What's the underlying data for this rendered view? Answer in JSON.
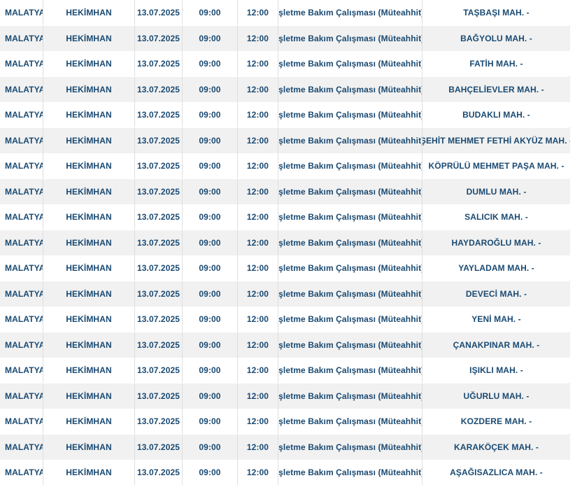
{
  "table": {
    "rows": [
      {
        "city": "MALATYA",
        "district": "HEKİMHAN",
        "date": "13.07.2025",
        "start": "09:00",
        "end": "12:00",
        "reason": "İşletme Bakım Çalışması (Müteahhit)",
        "place": "TAŞBAŞI MAH. -"
      },
      {
        "city": "MALATYA",
        "district": "HEKİMHAN",
        "date": "13.07.2025",
        "start": "09:00",
        "end": "12:00",
        "reason": "İşletme Bakım Çalışması (Müteahhit)",
        "place": "BAĞYOLU MAH. -"
      },
      {
        "city": "MALATYA",
        "district": "HEKİMHAN",
        "date": "13.07.2025",
        "start": "09:00",
        "end": "12:00",
        "reason": "İşletme Bakım Çalışması (Müteahhit)",
        "place": "FATİH MAH. -"
      },
      {
        "city": "MALATYA",
        "district": "HEKİMHAN",
        "date": "13.07.2025",
        "start": "09:00",
        "end": "12:00",
        "reason": "İşletme Bakım Çalışması (Müteahhit)",
        "place": "BAHÇELİEVLER MAH. -"
      },
      {
        "city": "MALATYA",
        "district": "HEKİMHAN",
        "date": "13.07.2025",
        "start": "09:00",
        "end": "12:00",
        "reason": "İşletme Bakım Çalışması (Müteahhit)",
        "place": "BUDAKLI MAH. -"
      },
      {
        "city": "MALATYA",
        "district": "HEKİMHAN",
        "date": "13.07.2025",
        "start": "09:00",
        "end": "12:00",
        "reason": "İşletme Bakım Çalışması (Müteahhit)",
        "place": "ŞEHİT MEHMET FETHİ AKYÜZ MAH. -"
      },
      {
        "city": "MALATYA",
        "district": "HEKİMHAN",
        "date": "13.07.2025",
        "start": "09:00",
        "end": "12:00",
        "reason": "İşletme Bakım Çalışması (Müteahhit)",
        "place": "KÖPRÜLÜ MEHMET PAŞA MAH. -"
      },
      {
        "city": "MALATYA",
        "district": "HEKİMHAN",
        "date": "13.07.2025",
        "start": "09:00",
        "end": "12:00",
        "reason": "İşletme Bakım Çalışması (Müteahhit)",
        "place": "DUMLU MAH. -"
      },
      {
        "city": "MALATYA",
        "district": "HEKİMHAN",
        "date": "13.07.2025",
        "start": "09:00",
        "end": "12:00",
        "reason": "İşletme Bakım Çalışması (Müteahhit)",
        "place": "SALICIK MAH. -"
      },
      {
        "city": "MALATYA",
        "district": "HEKİMHAN",
        "date": "13.07.2025",
        "start": "09:00",
        "end": "12:00",
        "reason": "İşletme Bakım Çalışması (Müteahhit)",
        "place": "HAYDAROĞLU MAH. -"
      },
      {
        "city": "MALATYA",
        "district": "HEKİMHAN",
        "date": "13.07.2025",
        "start": "09:00",
        "end": "12:00",
        "reason": "İşletme Bakım Çalışması (Müteahhit)",
        "place": "YAYLADAM MAH. -"
      },
      {
        "city": "MALATYA",
        "district": "HEKİMHAN",
        "date": "13.07.2025",
        "start": "09:00",
        "end": "12:00",
        "reason": "İşletme Bakım Çalışması (Müteahhit)",
        "place": "DEVECİ MAH. -"
      },
      {
        "city": "MALATYA",
        "district": "HEKİMHAN",
        "date": "13.07.2025",
        "start": "09:00",
        "end": "12:00",
        "reason": "İşletme Bakım Çalışması (Müteahhit)",
        "place": "YENİ MAH. -"
      },
      {
        "city": "MALATYA",
        "district": "HEKİMHAN",
        "date": "13.07.2025",
        "start": "09:00",
        "end": "12:00",
        "reason": "İşletme Bakım Çalışması (Müteahhit)",
        "place": "ÇANAKPINAR MAH. -"
      },
      {
        "city": "MALATYA",
        "district": "HEKİMHAN",
        "date": "13.07.2025",
        "start": "09:00",
        "end": "12:00",
        "reason": "İşletme Bakım Çalışması (Müteahhit)",
        "place": "IŞIKLI MAH. -"
      },
      {
        "city": "MALATYA",
        "district": "HEKİMHAN",
        "date": "13.07.2025",
        "start": "09:00",
        "end": "12:00",
        "reason": "İşletme Bakım Çalışması (Müteahhit)",
        "place": "UĞURLU MAH. -"
      },
      {
        "city": "MALATYA",
        "district": "HEKİMHAN",
        "date": "13.07.2025",
        "start": "09:00",
        "end": "12:00",
        "reason": "İşletme Bakım Çalışması (Müteahhit)",
        "place": "KOZDERE MAH. -"
      },
      {
        "city": "MALATYA",
        "district": "HEKİMHAN",
        "date": "13.07.2025",
        "start": "09:00",
        "end": "12:00",
        "reason": "İşletme Bakım Çalışması (Müteahhit)",
        "place": "KARAKÖÇEK MAH. -"
      },
      {
        "city": "MALATYA",
        "district": "HEKİMHAN",
        "date": "13.07.2025",
        "start": "09:00",
        "end": "12:00",
        "reason": "İşletme Bakım Çalışması (Müteahhit)",
        "place": "AŞAĞISAZLICA MAH. -"
      }
    ]
  },
  "colors": {
    "text": "#1a4a72",
    "row_alt": "#f1f1f1",
    "row_base": "#ffffff",
    "divider": "#dedede"
  }
}
